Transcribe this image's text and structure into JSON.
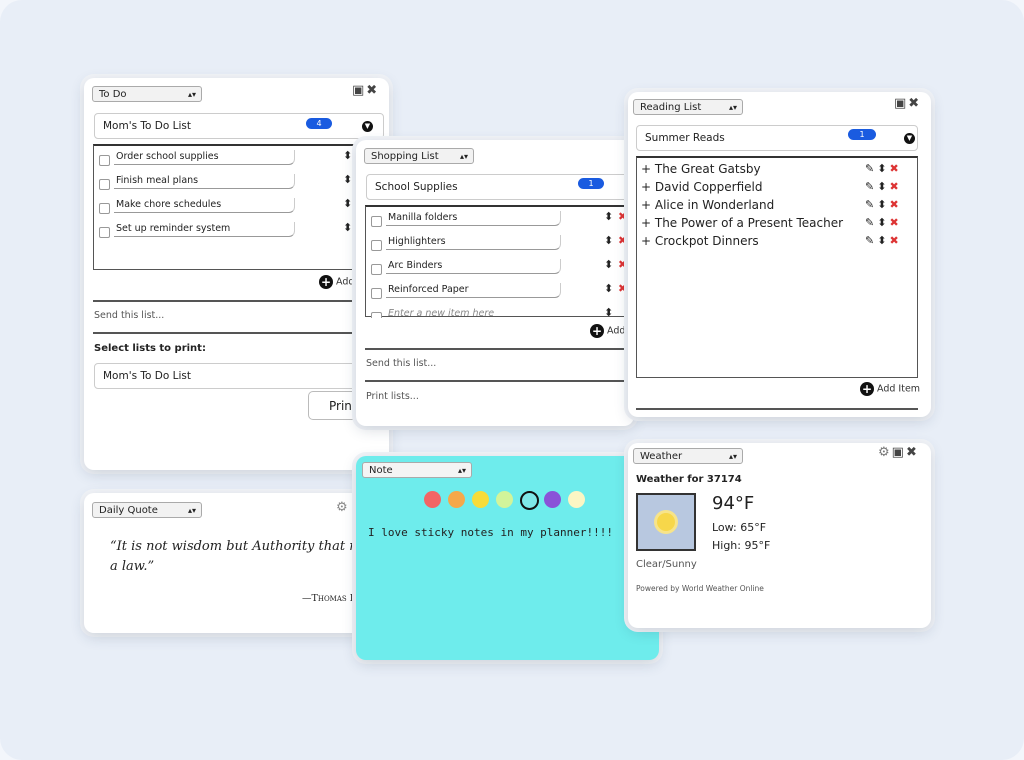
{
  "todo": {
    "selector": "To Do",
    "list_name": "Mom's To Do List",
    "count": "4",
    "items": [
      "Order school supplies",
      "Finish meal plans",
      "Make chore schedules",
      "Set up reminder system"
    ],
    "add_label": "Add",
    "send_label": "Send this list...",
    "print_heading": "Select lists to print:",
    "print_list": "Mom's To Do List",
    "print_button": "Print"
  },
  "shopping": {
    "selector": "Shopping List",
    "list_name": "School Supplies",
    "count": "1",
    "items": [
      "Manilla folders",
      "Highlighters",
      "Arc Binders",
      "Reinforced Paper"
    ],
    "new_item_placeholder": "Enter a new item here",
    "add_label": "Add",
    "send_label": "Send this list...",
    "print_label": "Print lists..."
  },
  "reading": {
    "selector": "Reading List",
    "list_name": "Summer Reads",
    "count": "1",
    "items": [
      "The Great Gatsby",
      "David Copperfield",
      "Alice in Wonderland",
      "The Power of a Present Teacher",
      "Crockpot Dinners"
    ],
    "add_label": "Add Item"
  },
  "quote": {
    "selector": "Daily Quote",
    "text": "“It is not wisdom but Authority that make",
    "text2": "a law.”",
    "author": "—Thomas H"
  },
  "note": {
    "selector": "Note",
    "text": "I love sticky notes in my planner!!!!",
    "colors": [
      "#f26565",
      "#f5a84a",
      "#f8dc3a",
      "#d2f49a",
      "#7ee8e8",
      "#8a52d8",
      "#fbf6c4"
    ],
    "background": "#6eecec"
  },
  "weather": {
    "selector": "Weather",
    "title": "Weather for 37174",
    "temp": "94°F",
    "low": "Low: 65°F",
    "high": "High: 95°F",
    "condition": "Clear/Sunny",
    "powered": "Powered by World Weather Online"
  }
}
